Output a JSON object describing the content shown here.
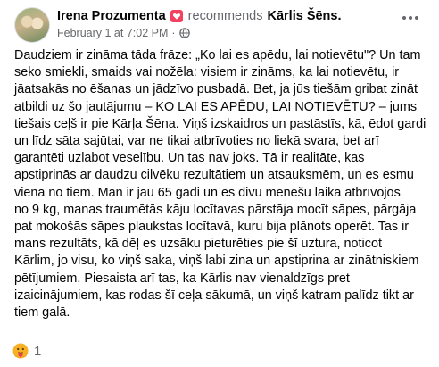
{
  "post": {
    "author": "Irena Prozumenta",
    "recommends_text": "recommends",
    "target": "Kārlis Šēns.",
    "timestamp": "February 1 at 7:02 PM",
    "separator": "·",
    "privacy_icon": "globe-icon",
    "recommend_badge_icon": "heart-flag-icon",
    "more_icon": "more-options-icon",
    "body": "Daudziem ir zināma tāda frāze: „Ko lai es apēdu, lai notievētu\"? Un tam\nseko smiekli, smaids vai nožēla: visiem ir zināms, ka lai notievētu, ir\njāatsakās no ēšanas un jādzīvo pusbadā. Bet, ja jūs tiešām gribat zināt\natbildi uz šo jautājumu – KO LAI ES  APĒDU, LAI NOTIEVĒTU? – jums\ntiešais ceļš ir pie Kārļa Šēna. Viņš izskaidros un pastāstīs, kā, ēdot gardi\nun līdz sāta sajūtai, var ne tikai atbrīvoties no liekā svara, bet arī\ngarantēti uzlabot veselību. Un tas nav joks. Tā ir realitāte, kas\napstiprinās ar daudzu cilvēku rezultātiem un atsauksmēm, un es esmu\nviena no tiem. Man ir jau 65 gadi un es divu mēnešu laikā atbrīvojos\nno 9 kg, manas traumētās kāju locītavas pārstāja mocīt sāpes, pārgāja\npat mokošās sāpes plaukstas locītavā, kuru bija plānots operēt. Tas ir\nmans rezultāts, kā dēļ es uzsāku pieturēties pie šī uztura, noticot\nKārlim, jo visu, ko viņš saka, viņš labi zina un apstiprina ar zinātniskiem\npētījumiem.  Piesaista arī  tas, ka Kārlis nav vienaldzīgs pret\nizaicinājumiem, kas rodas šī ceļa sākumā, un viņš katram palīdz tikt ar\ntiem galā.",
    "reaction_icon": "care-emoji-icon",
    "reaction_count": "1"
  }
}
